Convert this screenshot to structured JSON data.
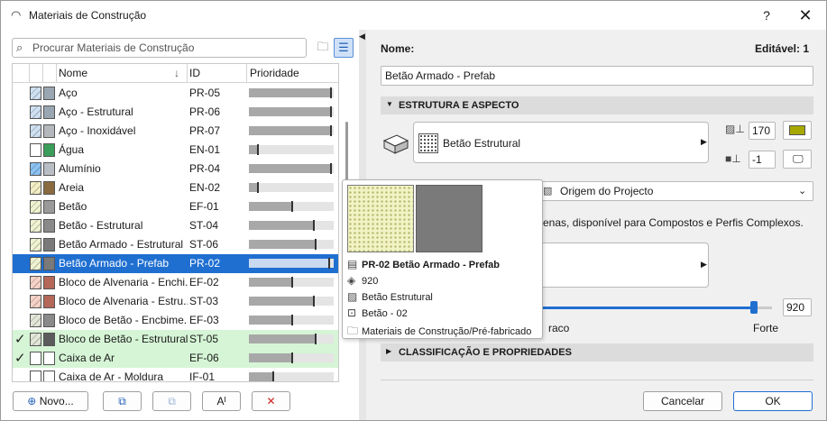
{
  "window": {
    "title": "Materiais de Construção",
    "help_label": "?",
    "close_label": "✕"
  },
  "search": {
    "placeholder": "Procurar Materiais de Construção"
  },
  "table": {
    "columns": [
      "Nome",
      "ID",
      "Prioridade"
    ],
    "sort_indicator": "↓",
    "rows": [
      {
        "name": "Aço",
        "id": "PR-05",
        "priority": 0.98,
        "check": "",
        "sw1": "#cfe0f2",
        "sw2": "#9aa7b3",
        "state": ""
      },
      {
        "name": "Aço - Estrutural",
        "id": "PR-06",
        "priority": 0.98,
        "check": "",
        "sw1": "#cfe0f2",
        "sw2": "#9aa7b3",
        "state": ""
      },
      {
        "name": "Aço - Inoxidável",
        "id": "PR-07",
        "priority": 0.98,
        "check": "",
        "sw1": "#cfe0f2",
        "sw2": "#b4b8bc",
        "state": ""
      },
      {
        "name": "Água",
        "id": "EN-01",
        "priority": 0.12,
        "check": "",
        "sw1": "#ffffff",
        "sw2": "#3a9e5a",
        "state": ""
      },
      {
        "name": "Alumínio",
        "id": "PR-04",
        "priority": 0.98,
        "check": "",
        "sw1": "#8cc3f2",
        "sw2": "#b8bec4",
        "state": ""
      },
      {
        "name": "Areia",
        "id": "EN-02",
        "priority": 0.12,
        "check": "",
        "sw1": "#f3eec4",
        "sw2": "#8a6a3f",
        "state": ""
      },
      {
        "name": "Betão",
        "id": "EF-01",
        "priority": 0.52,
        "check": "",
        "sw1": "#eef2d0",
        "sw2": "#9a9a9a",
        "state": ""
      },
      {
        "name": "Betão - Estrutural",
        "id": "ST-04",
        "priority": 0.78,
        "check": "",
        "sw1": "#eef2d0",
        "sw2": "#8a8a8a",
        "state": ""
      },
      {
        "name": "Betão Armado - Estrutural",
        "id": "ST-06",
        "priority": 0.8,
        "check": "",
        "sw1": "#eef2d0",
        "sw2": "#7a7a7a",
        "state": ""
      },
      {
        "name": "Betão Armado - Prefab",
        "id": "PR-02",
        "priority": 0.96,
        "check": "",
        "sw1": "#eef2d0",
        "sw2": "#7a7a7a",
        "state": "selected"
      },
      {
        "name": "Bloco de Alvenaria - Enchi...",
        "id": "EF-02",
        "priority": 0.52,
        "check": "",
        "sw1": "#f4d2c6",
        "sw2": "#b5675a",
        "state": ""
      },
      {
        "name": "Bloco de Alvenaria - Estru...",
        "id": "ST-03",
        "priority": 0.78,
        "check": "",
        "sw1": "#f4d2c6",
        "sw2": "#b5675a",
        "state": ""
      },
      {
        "name": "Bloco de Betão - Encbime...",
        "id": "EF-03",
        "priority": 0.52,
        "check": "",
        "sw1": "#e2e6d8",
        "sw2": "#8a8a8a",
        "state": ""
      },
      {
        "name": "Bloco de Betão - Estrutural",
        "id": "ST-05",
        "priority": 0.8,
        "check": "✓",
        "sw1": "#e2e6d8",
        "sw2": "#5c5c5c",
        "state": "green"
      },
      {
        "name": "Caixa de Ar",
        "id": "EF-06",
        "priority": 0.52,
        "check": "✓",
        "sw1": "#ffffff",
        "sw2": "#ffffff",
        "state": "green"
      },
      {
        "name": "Caixa de Ar - Moldura",
        "id": "IF-01",
        "priority": 0.3,
        "check": "",
        "sw1": "#ffffff",
        "sw2": "#ffffff",
        "state": ""
      }
    ]
  },
  "buttons": {
    "new_label": "Novo...",
    "new_icon": "plus-circle-icon",
    "duplicate_icon": "duplicate-icon",
    "import_icon": "import-icon",
    "rename_icon": "rename-icon",
    "rename_glyph": "Aᴵ",
    "delete_icon": "delete-x-icon",
    "delete_glyph": "✕",
    "cancel_label": "Cancelar",
    "ok_label": "OK"
  },
  "details": {
    "name_label": "Nome:",
    "editable_label": "Editável: 1",
    "name_value": "Betão Armado - Prefab",
    "section_structure": "ESTRUTURA E ASPECTO",
    "section_classification": "CLASSIFICAÇÃO E PROPRIEDADES",
    "cut_fill_label": "Betão Estrutural",
    "pen_value_1": "170",
    "pen_value_2": "-1",
    "orientation_value": "Origem do Projecto",
    "note_text": "enas, disponível para Compostos e Perfis Complexos.",
    "slider_left_label": "raco",
    "slider_right_label": "Forte",
    "slider_value": "920",
    "slider_fraction": 0.92,
    "accent_color": "#a7a800"
  },
  "tooltip": {
    "title": "PR-02 Betão Armado - Prefab",
    "priority": "920",
    "cut_fill": "Betão Estrutural",
    "pen": "Betão - 02",
    "folder": "Materiais de Construção/Pré-fabricado"
  }
}
